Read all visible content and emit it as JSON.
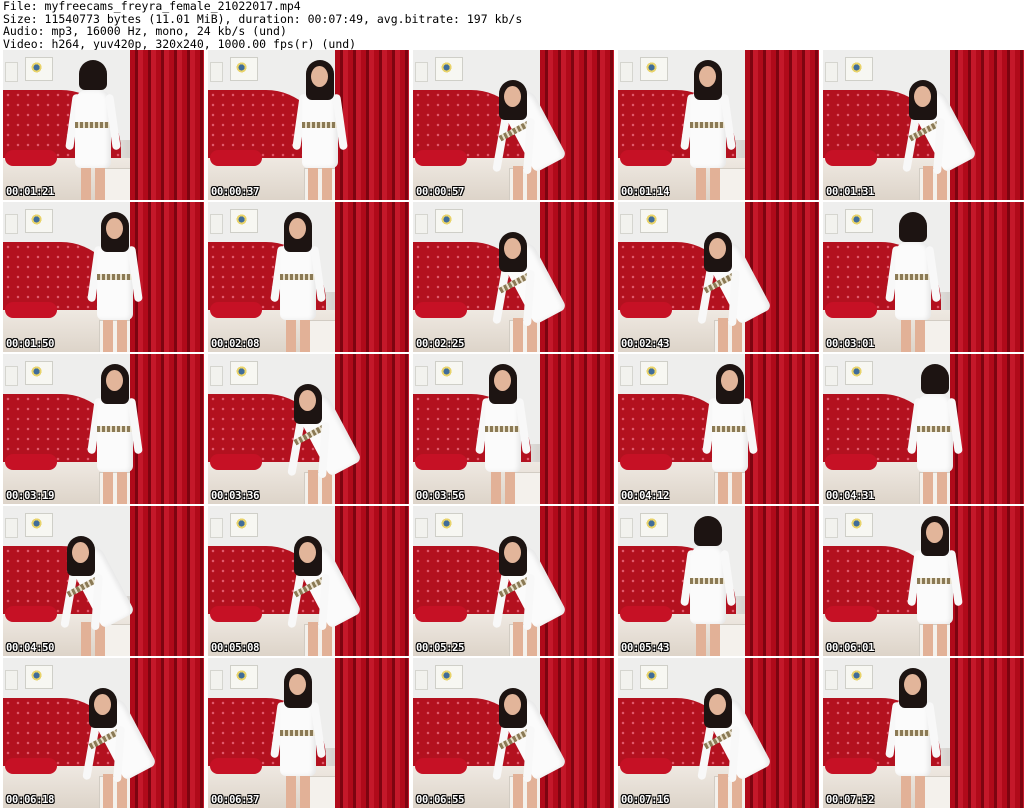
{
  "header": {
    "file": "File: myfreecams_freyra_female_21022017.mp4",
    "size": "Size: 11540773 bytes (11.01 MiB), duration: 00:07:49, avg.bitrate: 197 kb/s",
    "audio": "Audio: mp3, 16000 Hz, mono, 24 kb/s (und)",
    "video": "Video: h264, yuv420p, 320x240, 1000.00 fps(r) (und)"
  },
  "thumbnails": [
    {
      "timestamp": "00:01:21",
      "pose": "back"
    },
    {
      "timestamp": "00:00:37",
      "pose": "stand"
    },
    {
      "timestamp": "00:00:57",
      "pose": "bend"
    },
    {
      "timestamp": "00:01:14",
      "pose": "stand"
    },
    {
      "timestamp": "00:01:31",
      "pose": "bend"
    },
    {
      "timestamp": "00:01:50",
      "pose": "stand"
    },
    {
      "timestamp": "00:02:08",
      "pose": "stand"
    },
    {
      "timestamp": "00:02:25",
      "pose": "bend"
    },
    {
      "timestamp": "00:02:43",
      "pose": "bend"
    },
    {
      "timestamp": "00:03:01",
      "pose": "back"
    },
    {
      "timestamp": "00:03:19",
      "pose": "stand"
    },
    {
      "timestamp": "00:03:36",
      "pose": "bend"
    },
    {
      "timestamp": "00:03:56",
      "pose": "stand"
    },
    {
      "timestamp": "00:04:12",
      "pose": "stand"
    },
    {
      "timestamp": "00:04:31",
      "pose": "back"
    },
    {
      "timestamp": "00:04:50",
      "pose": "bend"
    },
    {
      "timestamp": "00:05:08",
      "pose": "bend"
    },
    {
      "timestamp": "00:05:25",
      "pose": "bend"
    },
    {
      "timestamp": "00:05:43",
      "pose": "back"
    },
    {
      "timestamp": "00:06:01",
      "pose": "stand"
    },
    {
      "timestamp": "00:06:18",
      "pose": "bend"
    },
    {
      "timestamp": "00:06:37",
      "pose": "stand"
    },
    {
      "timestamp": "00:06:55",
      "pose": "bend"
    },
    {
      "timestamp": "00:07:16",
      "pose": "bend"
    },
    {
      "timestamp": "00:07:32",
      "pose": "stand"
    }
  ],
  "colors": {
    "curtain": "#b00a1a",
    "headboard": "#b3111f",
    "dress": "#fbfbfb",
    "timestamp_text": "#ffffff"
  }
}
